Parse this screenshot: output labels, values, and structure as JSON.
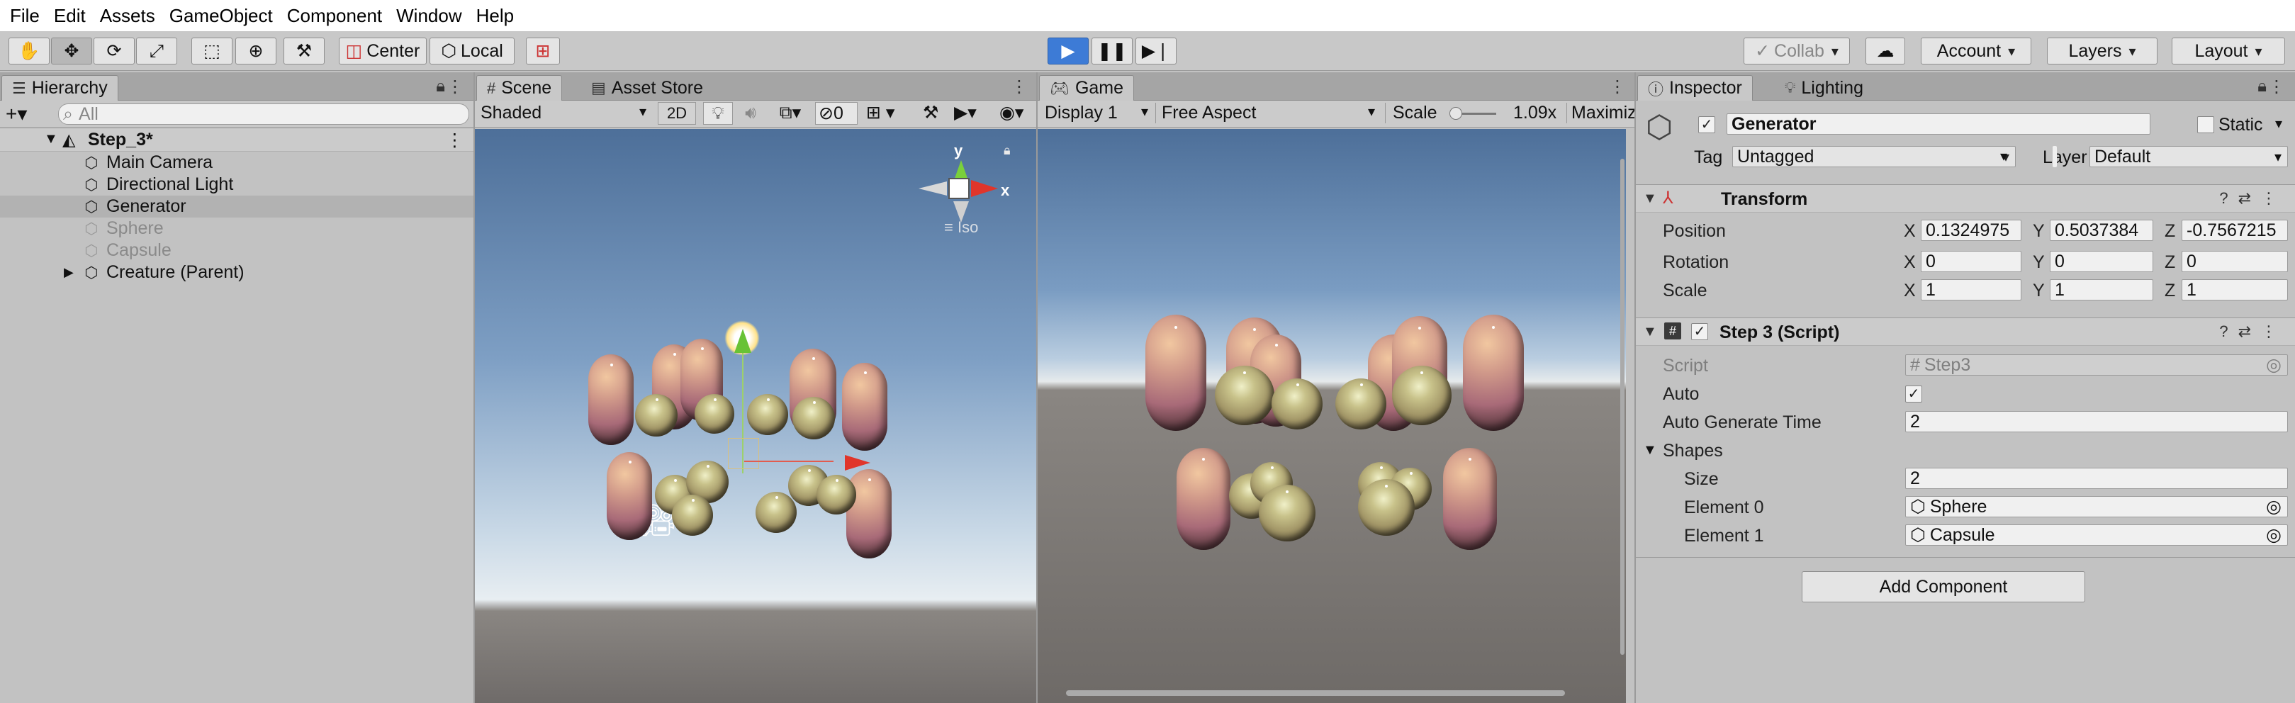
{
  "menu": [
    "File",
    "Edit",
    "Assets",
    "GameObject",
    "Component",
    "Window",
    "Help"
  ],
  "toolbar": {
    "pivot": "Center",
    "space": "Local",
    "collab": "Collab",
    "account": "Account",
    "layers": "Layers",
    "layout": "Layout"
  },
  "hierarchy": {
    "tab": "Hierarchy",
    "search_placeholder": "All",
    "scene_name": "Step_3*",
    "items": [
      "Main Camera",
      "Directional Light",
      "Generator",
      "Sphere",
      "Capsule",
      "Creature (Parent)"
    ]
  },
  "scene": {
    "tab": "Scene",
    "tab2": "Asset Store",
    "shading": "Shaded",
    "mode_2d": "2D",
    "hidden_count": "0",
    "gizmo_x": "x",
    "gizmo_y": "y",
    "projection": "Iso"
  },
  "game": {
    "tab": "Game",
    "display": "Display 1",
    "aspect": "Free Aspect",
    "scale_label": "Scale",
    "scale_value": "1.09x",
    "maximize": "Maximize"
  },
  "inspector": {
    "tab": "Inspector",
    "tab2": "Lighting",
    "object_name": "Generator",
    "static_label": "Static",
    "tag_label": "Tag",
    "tag_value": "Untagged",
    "layer_label": "Layer",
    "layer_value": "Default",
    "transform": {
      "title": "Transform",
      "position_label": "Position",
      "rotation_label": "Rotation",
      "scale_label": "Scale",
      "position": {
        "x": "0.1324975",
        "y": "0.5037384",
        "z": "-0.7567215"
      },
      "rotation": {
        "x": "0",
        "y": "0",
        "z": "0"
      },
      "scale": {
        "x": "1",
        "y": "1",
        "z": "1"
      },
      "axis_x": "X",
      "axis_y": "Y",
      "axis_z": "Z"
    },
    "script_component": {
      "title": "Step 3 (Script)",
      "script_label": "Script",
      "script_value": "Step3",
      "auto_label": "Auto",
      "auto_time_label": "Auto Generate Time",
      "auto_time_value": "2",
      "shapes_label": "Shapes",
      "size_label": "Size",
      "size_value": "2",
      "element0_label": "Element 0",
      "element0_value": "Sphere",
      "element1_label": "Element 1",
      "element1_value": "Capsule"
    },
    "add_component": "Add Component"
  }
}
